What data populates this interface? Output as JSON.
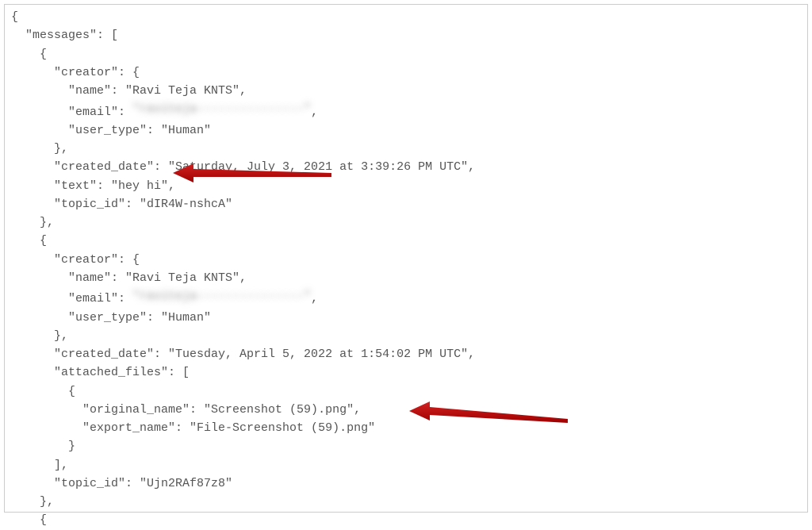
{
  "json_content": {
    "open_brace": "{",
    "messages_key": "  \"messages\": [",
    "m0_open": "    {",
    "m0_creator_open": "      \"creator\": {",
    "m0_creator_name": "        \"name\": \"Ravi Teja KNTS\",",
    "m0_creator_email_prefix": "        \"email\": ",
    "m0_creator_email_blur": "\"raviteja---------------\"",
    "m0_creator_email_suffix": ",",
    "m0_creator_usertype": "        \"user_type\": \"Human\"",
    "m0_creator_close": "      },",
    "m0_created": "      \"created_date\": \"Saturday, July 3, 2021 at 3:39:26 PM UTC\",",
    "m0_text": "      \"text\": \"hey hi\",",
    "m0_topic": "      \"topic_id\": \"dIR4W-nshcA\"",
    "m0_close": "    },",
    "m1_open": "    {",
    "m1_creator_open": "      \"creator\": {",
    "m1_creator_name": "        \"name\": \"Ravi Teja KNTS\",",
    "m1_creator_email_prefix": "        \"email\": ",
    "m1_creator_email_blur": "\"raviteja---------------\"",
    "m1_creator_email_suffix": ",",
    "m1_creator_usertype": "        \"user_type\": \"Human\"",
    "m1_creator_close": "      },",
    "m1_created": "      \"created_date\": \"Tuesday, April 5, 2022 at 1:54:02 PM UTC\",",
    "m1_attached_open": "      \"attached_files\": [",
    "m1_file_open": "        {",
    "m1_file_original": "          \"original_name\": \"Screenshot (59).png\",",
    "m1_file_export": "          \"export_name\": \"File-Screenshot (59).png\"",
    "m1_file_close": "        }",
    "m1_attached_close": "      ],",
    "m1_topic": "      \"topic_id\": \"Ujn2RAf87z8\"",
    "m1_close": "    },",
    "m2_open": "    {"
  },
  "arrow_color": "#C00000"
}
